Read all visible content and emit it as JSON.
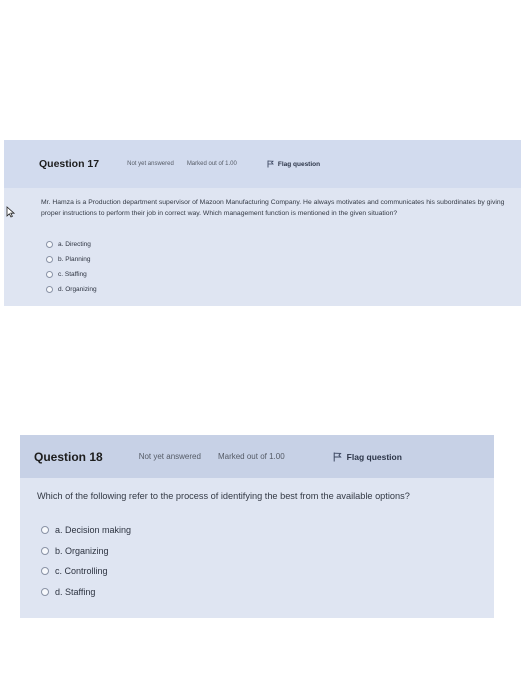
{
  "q17": {
    "title": "Question 17",
    "status": "Not yet answered",
    "marks": "Marked out of 1.00",
    "flag_label": "Flag question",
    "text": "Mr. Hamza is a Production department supervisor of Mazoon Manufacturing Company. He always motivates and communicates his subordinates by giving proper instructions to perform their job in correct way. Which management function is mentioned in the given situation?",
    "options": [
      "a. Directing",
      "b. Planning",
      "c. Staffing",
      "d. Organizing"
    ]
  },
  "q18": {
    "title": "Question 18",
    "status": "Not yet answered",
    "marks": "Marked out of 1.00",
    "flag_label": "Flag question",
    "text": "Which of the following refer to the process of identifying the best from the available options?",
    "options": [
      "a. Decision making",
      "b. Organizing",
      "c. Controlling",
      "d. Staffing"
    ]
  },
  "colors": {
    "card_bg": "#dfe5f2",
    "header_bg": "#c7d1e6",
    "text": "#333944"
  },
  "icons": [
    "flag-icon",
    "mouse-cursor-icon",
    "radio-button"
  ]
}
